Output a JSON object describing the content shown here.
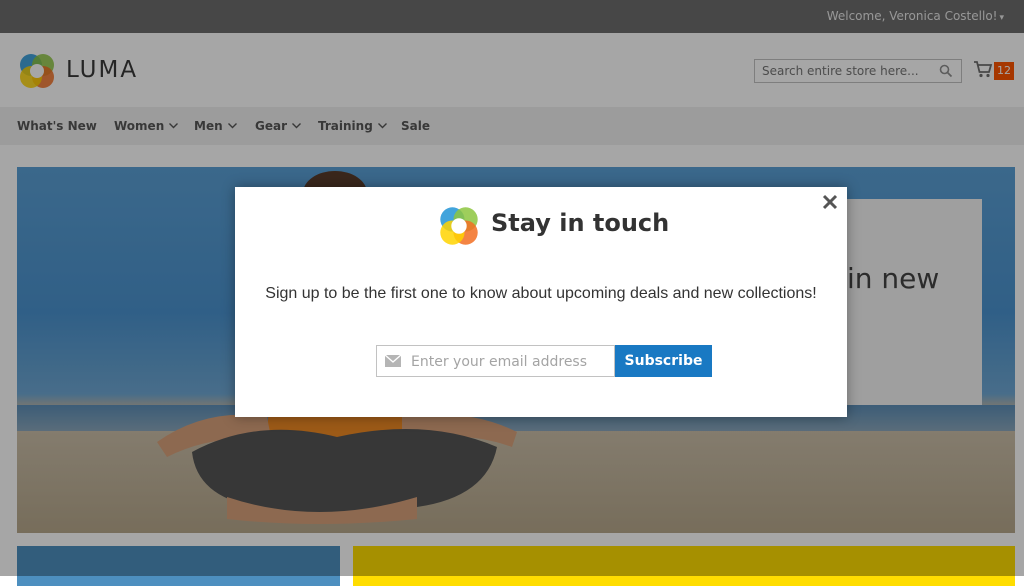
{
  "header": {
    "welcome": "Welcome, Veronica Costello!",
    "logo_text": "LUMA",
    "search_placeholder": "Search entire store here...",
    "cart_count": "12"
  },
  "nav": {
    "items": [
      {
        "label": "What's New",
        "has_dropdown": false
      },
      {
        "label": "Women",
        "has_dropdown": true
      },
      {
        "label": "Men",
        "has_dropdown": true
      },
      {
        "label": "Gear",
        "has_dropdown": true
      },
      {
        "label": "Training",
        "has_dropdown": true
      },
      {
        "label": "Sale",
        "has_dropdown": false
      }
    ]
  },
  "hero": {
    "card_text": "in new"
  },
  "modal": {
    "title": "Stay in touch",
    "text": "Sign up to be the first one to know about upcoming deals and new collections!",
    "email_placeholder": "Enter your email address",
    "subscribe_label": "Subscribe"
  },
  "icons": {
    "close": "close-icon",
    "mail": "mail-icon",
    "search": "search-icon",
    "cart": "cart-icon",
    "chevron": "chevron-down-icon"
  },
  "colors": {
    "primary_button": "#1979c3",
    "cart_badge": "#ff5501",
    "logo_blue": "#2d9ad8",
    "logo_green": "#8dc63f",
    "logo_orange": "#f26e22",
    "logo_yellow": "#ffd400",
    "promo_yellow": "#ffdd00"
  }
}
